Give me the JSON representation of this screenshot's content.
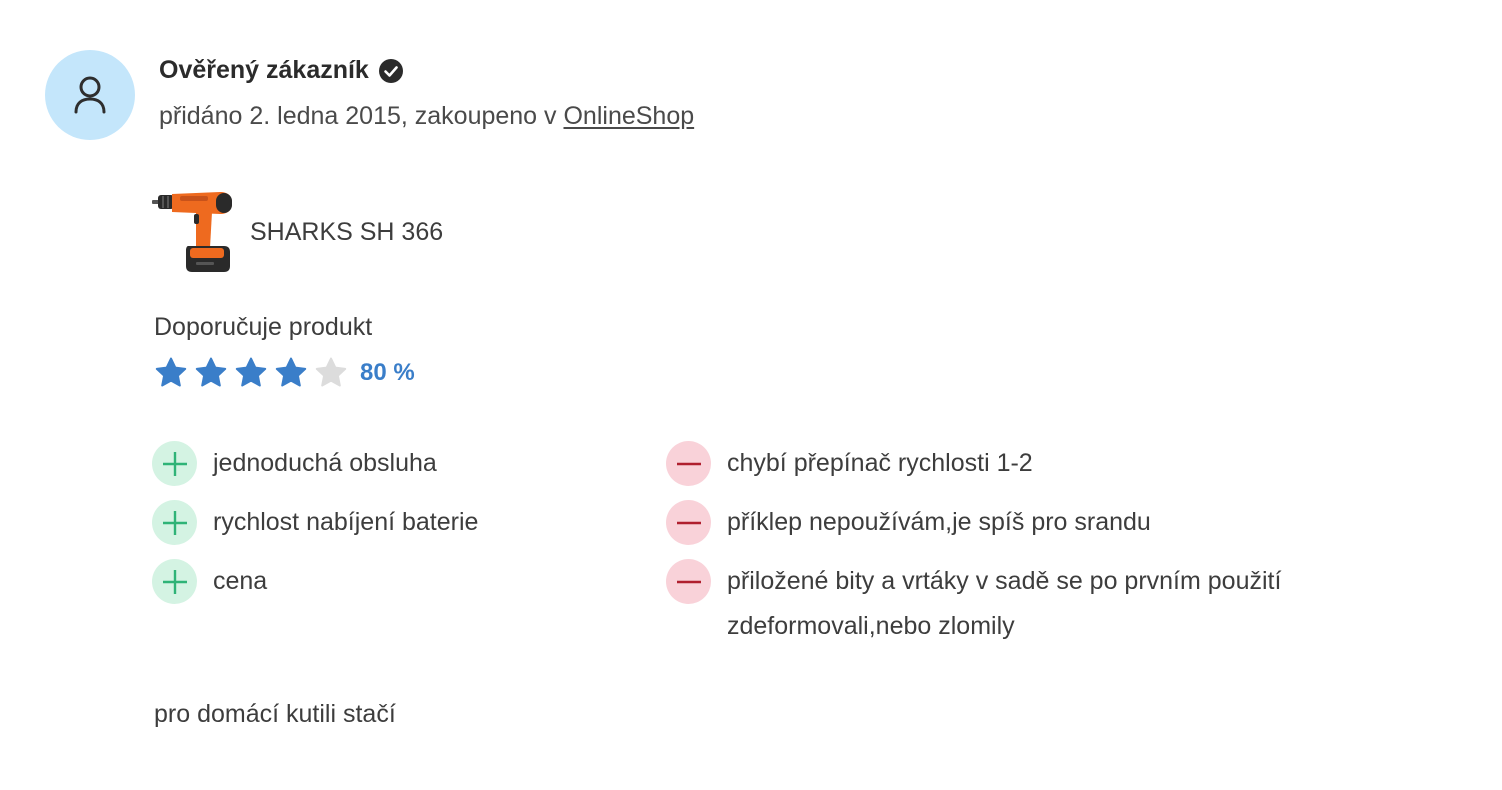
{
  "review": {
    "author": "Ověřený zákazník",
    "verified_icon": "check-circle-icon",
    "meta_prefix": "přidáno 2. ledna 2015, zakoupeno v ",
    "shop_link": "OnlineShop",
    "product": {
      "name": "SHARKS SH 366",
      "image_icon": "cordless-drill-image"
    },
    "recommend_label": "Doporučuje produkt",
    "rating": {
      "value": 4,
      "max": 5,
      "percent_label": "80 %",
      "star_color": "#3a7ec9",
      "empty_star_color": "#dcdcdc"
    },
    "pros": [
      "jednoduchá obsluha",
      "rychlost nabíjení baterie",
      "cena"
    ],
    "cons": [
      "chybí přepínač rychlosti 1-2",
      "příklep nepoužívám,je spíš pro srandu",
      "přiložené bity a vrtáky v sadě se po prvním použití zdeformovali,nebo zlomily"
    ],
    "summary": "pro domácí kutili stačí",
    "colors": {
      "avatar_bg": "#c4e6fb",
      "plus_bg": "#d4f3e3",
      "plus_fg": "#2fb377",
      "minus_bg": "#f9d2d9",
      "minus_fg": "#b01f2e"
    }
  }
}
